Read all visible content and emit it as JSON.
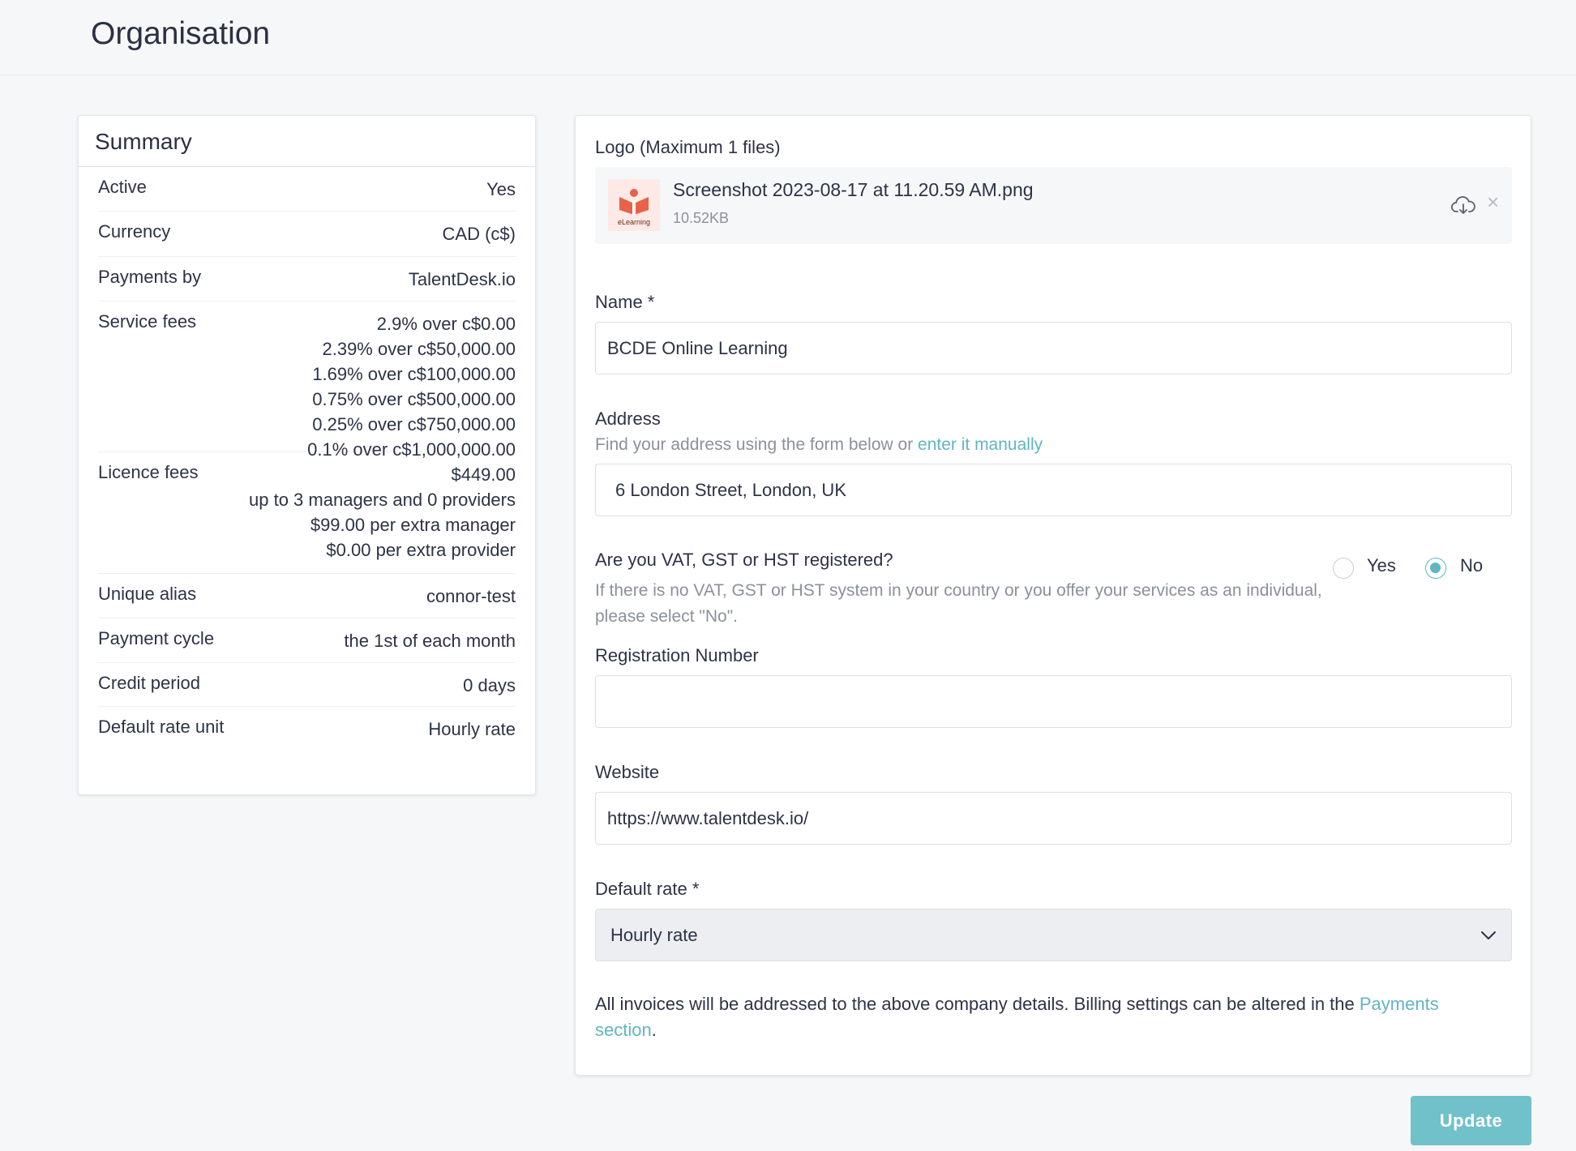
{
  "page": {
    "title": "Organisation"
  },
  "summary": {
    "title": "Summary",
    "rows": [
      {
        "label": "Active",
        "values": [
          "Yes"
        ]
      },
      {
        "label": "Currency",
        "values": [
          "CAD (c$)"
        ]
      },
      {
        "label": "Payments by",
        "values": [
          "TalentDesk.io"
        ]
      },
      {
        "label": "Service fees",
        "values": [
          "2.9% over c$0.00",
          "2.39% over c$50,000.00",
          "1.69% over c$100,000.00",
          "0.75% over c$500,000.00",
          "0.25% over c$750,000.00",
          "0.1% over c$1,000,000.00"
        ]
      },
      {
        "label": "Licence fees",
        "values": [
          "$449.00",
          "up to 3 managers and 0 providers",
          "$99.00 per extra manager",
          "$0.00 per extra provider"
        ]
      },
      {
        "label": "Unique alias",
        "values": [
          "connor-test"
        ]
      },
      {
        "label": "Payment cycle",
        "values": [
          "the 1st of each month"
        ]
      },
      {
        "label": "Credit period",
        "values": [
          "0 days"
        ]
      },
      {
        "label": "Default rate unit",
        "values": [
          "Hourly rate"
        ]
      }
    ]
  },
  "form": {
    "logo": {
      "label": "Logo (Maximum 1 files)",
      "file_name": "Screenshot 2023-08-17 at 11.20.59 AM.png",
      "file_size": "10.52KB",
      "thumb_text": "eLearning",
      "remove_symbol": "×"
    },
    "name": {
      "label": "Name *",
      "value": "BCDE Online Learning"
    },
    "address": {
      "label": "Address",
      "hint_prefix": "Find your address using the form below or ",
      "hint_link": "enter it manually",
      "value": "6 London Street, London, UK"
    },
    "vat": {
      "question": "Are you VAT, GST or HST registered?",
      "hint": "If there is no VAT, GST or HST system in your country or you offer your services as an individual, please select \"No\".",
      "options": [
        {
          "label": "Yes",
          "checked": false
        },
        {
          "label": "No",
          "checked": true
        }
      ]
    },
    "registration": {
      "label": "Registration Number",
      "value": ""
    },
    "website": {
      "label": "Website",
      "value": "https://www.talentdesk.io/"
    },
    "default_rate": {
      "label": "Default rate *",
      "value": "Hourly rate"
    },
    "footer": {
      "text": "All invoices will be addressed to the above company details. Billing settings can be altered in the ",
      "link": "Payments section",
      "suffix": "."
    }
  },
  "actions": {
    "update_label": "Update"
  },
  "colors": {
    "accent": "#5fb6c0",
    "button": "#70c1c9",
    "text": "#2c3345",
    "muted": "#8b909b"
  }
}
